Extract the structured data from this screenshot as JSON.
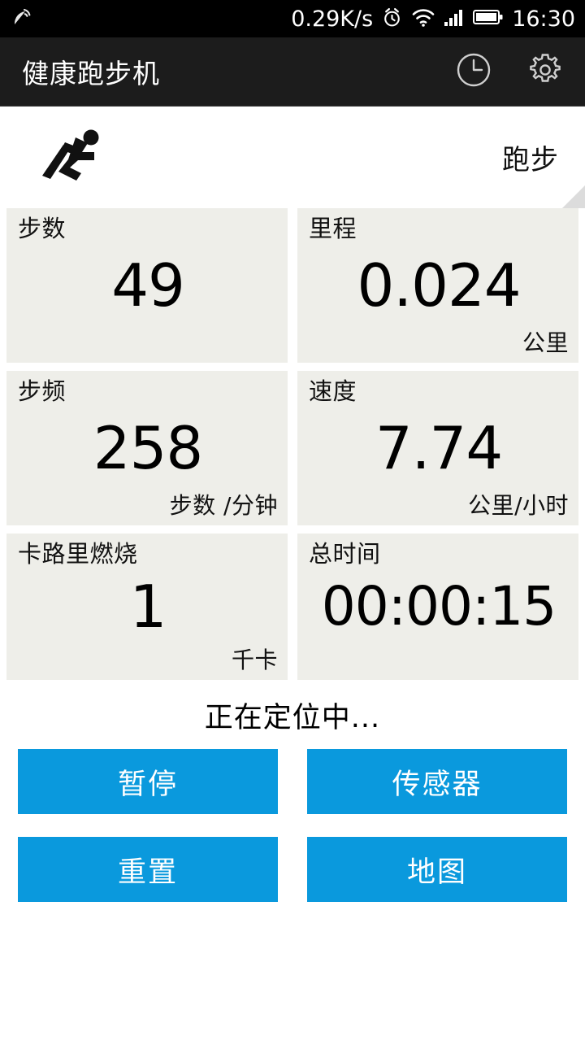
{
  "statusbar": {
    "gps_icon": "satellite-dish-icon",
    "network_speed": "0.29K/s",
    "alarm_icon": "alarm-clock-icon",
    "wifi_icon": "wifi-icon",
    "signal_icon": "cellular-signal-icon",
    "battery_icon": "battery-icon",
    "clock": "16:30"
  },
  "titlebar": {
    "title": "健康跑步机",
    "history_icon": "clock-history-icon",
    "settings_icon": "gear-icon"
  },
  "mode": {
    "runner_icon": "runner-icon",
    "label": "跑步",
    "spinner_icon": "spinner-triangle-icon"
  },
  "metrics": [
    {
      "name": "steps",
      "label": "步数",
      "value": "49",
      "unit": ""
    },
    {
      "name": "distance",
      "label": "里程",
      "value": "0.024",
      "unit": "公里"
    },
    {
      "name": "cadence",
      "label": "步频",
      "value": "258",
      "unit": "步数 /分钟"
    },
    {
      "name": "speed",
      "label": "速度",
      "value": "7.74",
      "unit": "公里/小时"
    },
    {
      "name": "calories",
      "label": "卡路里燃烧",
      "value": "1",
      "unit": "千卡"
    },
    {
      "name": "total-time",
      "label": "总时间",
      "value": "00:00:15",
      "unit": ""
    }
  ],
  "status_message": "正在定位中...",
  "buttons": [
    {
      "name": "pause",
      "label": "暂停"
    },
    {
      "name": "sensor",
      "label": "传感器"
    },
    {
      "name": "reset",
      "label": "重置"
    },
    {
      "name": "map",
      "label": "地图"
    }
  ],
  "colors": {
    "accent_blue": "#0a99dd",
    "card_bg": "#eeeee9",
    "titlebar_bg": "#1c1c1c",
    "statusbar_bg": "#000000",
    "page_bg": "#ffffff"
  }
}
